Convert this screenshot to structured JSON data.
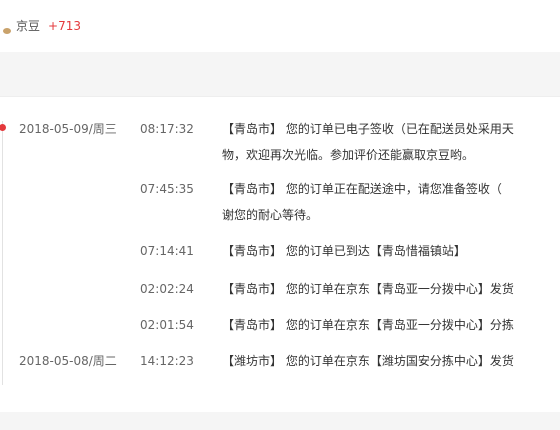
{
  "reward": {
    "icon": "jingdou-bean-icon",
    "label": "京豆",
    "amount": "+713",
    "colors": {
      "amount": "#e4393c"
    }
  },
  "tracking": {
    "colors": {
      "dot": "#e4393c",
      "line": "#e2e2e2"
    },
    "rows": [
      {
        "date": "2018-05-09/周三",
        "time": "08:17:32",
        "message": "【青岛市】 您的订单已电子签收（已在配送员处采用天",
        "message_cont": "物，欢迎再次光临。参加评价还能赢取京豆哟。"
      },
      {
        "date": "",
        "time": "07:45:35",
        "message": "【青岛市】 您的订单正在配送途中，请您准备签收（",
        "message_cont": "谢您的耐心等待。"
      },
      {
        "date": "",
        "time": "07:14:41",
        "message": "【青岛市】 您的订单已到达【青岛惜福镇站】",
        "message_cont": ""
      },
      {
        "date": "",
        "time": "02:02:24",
        "message": "【青岛市】 您的订单在京东【青岛亚一分拨中心】发货",
        "message_cont": ""
      },
      {
        "date": "",
        "time": "02:01:54",
        "message": "【青岛市】 您的订单在京东【青岛亚一分拨中心】分拣",
        "message_cont": ""
      },
      {
        "date": "2018-05-08/周二",
        "time": "14:12:23",
        "message": "【潍坊市】 您的订单在京东【潍坊国安分拣中心】发货",
        "message_cont": ""
      }
    ]
  }
}
